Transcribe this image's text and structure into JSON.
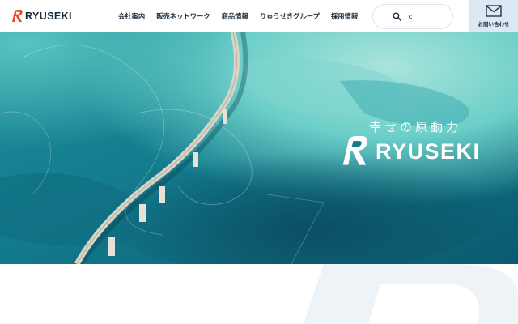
{
  "header": {
    "brand": "RYUSEKI",
    "nav": [
      {
        "label": "会社案内"
      },
      {
        "label": "販売ネットワーク"
      },
      {
        "label": "商品情報"
      },
      {
        "label": "りゅうせきグループ"
      },
      {
        "label": "採用情報"
      }
    ],
    "search": {
      "icon": "search-icon",
      "value": "ｃ"
    },
    "contact": {
      "icon": "mail-icon",
      "label": "お問い合わせ"
    }
  },
  "hero": {
    "tagline": "幸せの原動力",
    "brand": "RYUSEKI"
  },
  "colors": {
    "brand_orange": "#e8481c",
    "brand_navy": "#1b2b3c",
    "contact_bg": "#dce8f3",
    "sea_deep": "#0d5f72",
    "sea_light": "#6fd0cf"
  }
}
